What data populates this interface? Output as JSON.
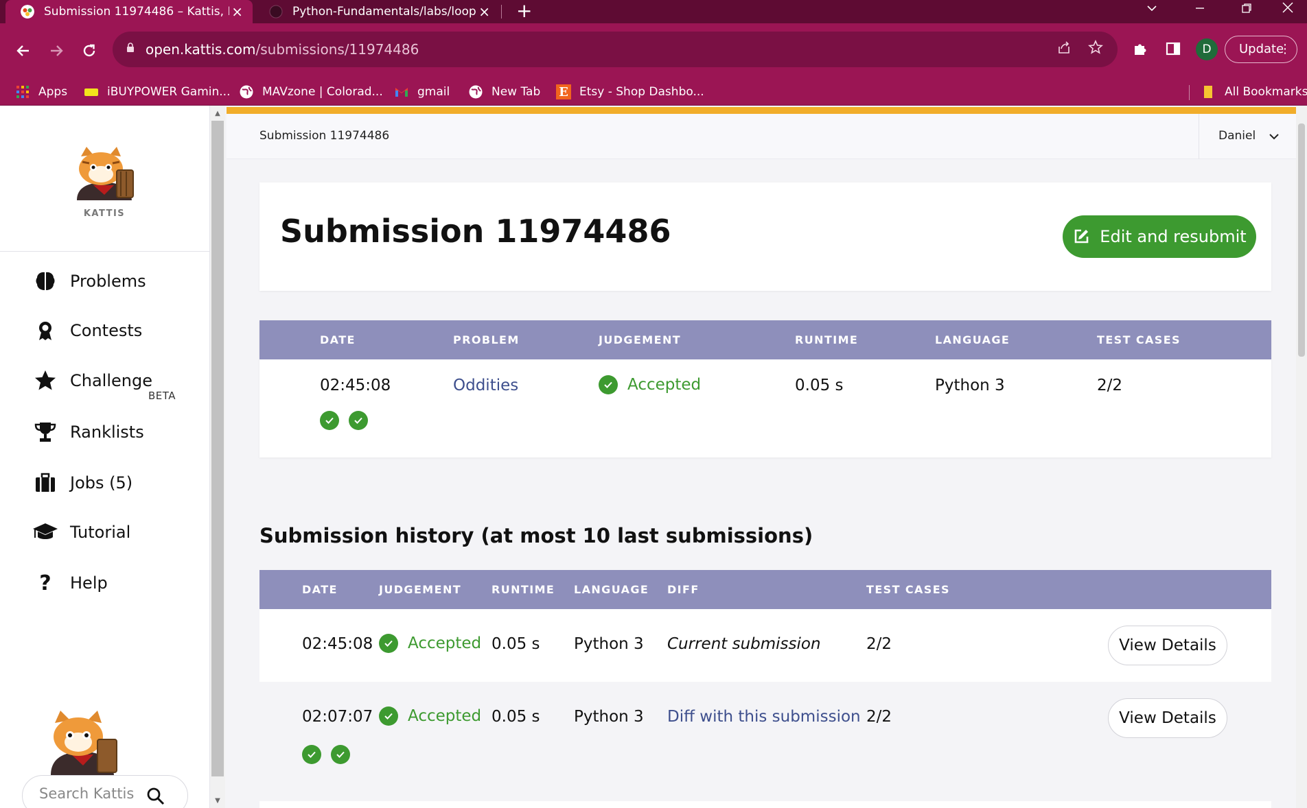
{
  "browser": {
    "tabs": [
      {
        "title": "Submission 11974486 – Kattis, K",
        "active": true
      },
      {
        "title": "Python-Fundamentals/labs/loop",
        "active": false
      }
    ],
    "new_tab_symbol": "+",
    "url_host": "open.kattis.com",
    "url_path": "/submissions/11974486",
    "profile_initial": "D",
    "update_label": "Update",
    "bookmarks": [
      {
        "label": "Apps",
        "icon": "apps-grid-icon"
      },
      {
        "label": "iBUYPOWER Gamin...",
        "icon": "ibuypower-icon"
      },
      {
        "label": "MAVzone | Colorad...",
        "icon": "globe-icon"
      },
      {
        "label": "gmail",
        "icon": "gmail-icon"
      },
      {
        "label": "New Tab",
        "icon": "globe-icon"
      },
      {
        "label": "Etsy - Shop Dashbo...",
        "icon": "etsy-icon"
      }
    ],
    "all_bookmarks_label": "All Bookmarks"
  },
  "sidebar": {
    "logo_label": "KATTIS",
    "nav": [
      {
        "label": "Problems",
        "icon": "brain-icon"
      },
      {
        "label": "Contests",
        "icon": "contest-icon"
      },
      {
        "label": "Challenge",
        "icon": "star-icon"
      },
      {
        "label": "Ranklists",
        "icon": "trophy-icon"
      },
      {
        "label": "Jobs (5)",
        "icon": "briefcase-icon"
      },
      {
        "label": "Tutorial",
        "icon": "graduation-cap-icon"
      },
      {
        "label": "Help",
        "icon": "question-icon"
      }
    ],
    "beta_label": "BETA",
    "search_placeholder": "Search Kattis"
  },
  "topbar": {
    "breadcrumb": "Submission 11974486",
    "user": "Daniel"
  },
  "submission": {
    "title": "Submission 11974486",
    "resubmit_label": "Edit and resubmit",
    "headers": [
      "DATE",
      "PROBLEM",
      "JUDGEMENT",
      "RUNTIME",
      "LANGUAGE",
      "TEST CASES"
    ],
    "row": {
      "date": "02:45:08",
      "problem": "Oddities",
      "judgement": "Accepted",
      "runtime": "0.05 s",
      "language": "Python 3",
      "test_cases": "2/2",
      "passed_tests": 2
    }
  },
  "history": {
    "title": "Submission history (at most 10 last submissions)",
    "headers": [
      "DATE",
      "JUDGEMENT",
      "RUNTIME",
      "LANGUAGE",
      "DIFF",
      "TEST CASES"
    ],
    "rows": [
      {
        "date": "02:45:08",
        "judgement": "Accepted",
        "runtime": "0.05 s",
        "language": "Python 3",
        "diff": "Current submission",
        "test_cases": "2/2",
        "button": "View Details"
      },
      {
        "date": "02:07:07",
        "judgement": "Accepted",
        "runtime": "0.05 s",
        "language": "Python 3",
        "diff": "Diff with this submission",
        "test_cases": "2/2",
        "button": "View Details",
        "passed_tests": 2
      }
    ]
  },
  "colors": {
    "accent_bar": "#f1ad2a",
    "accepted_green": "#3d9a30",
    "table_header": "#8e8fbb",
    "link_blue": "#3e4f8d",
    "browser_frame": "#9b1554"
  }
}
